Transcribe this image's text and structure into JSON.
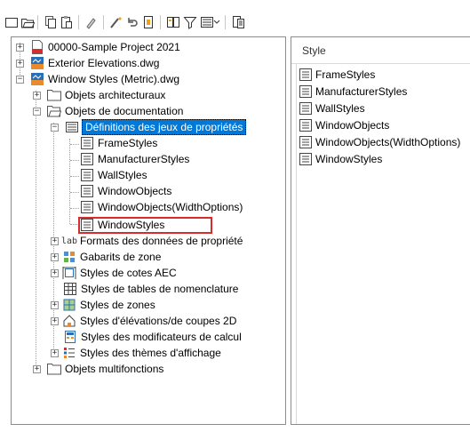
{
  "toolbar": {
    "buttons": [
      "new-icon",
      "open-icon",
      "copy-icon",
      "paste-icon",
      "purge-icon",
      "repath-icon",
      "undo-icon",
      "transfer-icon",
      "compare-icon",
      "filter-icon",
      "view-mode-icon",
      "dropdown-icon",
      "publish-icon"
    ]
  },
  "tree": {
    "items": [
      {
        "label": "00000-Sample Project 2021",
        "icon": "pdf-file-icon"
      },
      {
        "label": "Exterior Elevations.dwg",
        "icon": "dwg-file-icon"
      },
      {
        "label": "Window Styles (Metric).dwg",
        "icon": "dwg-file-icon"
      },
      {
        "label": "Objets architecturaux",
        "icon": "folder-icon"
      },
      {
        "label": "Objets de documentation",
        "icon": "folder-open-icon"
      },
      {
        "label": "Définitions des jeux de propriétés",
        "icon": "property-set-icon"
      },
      {
        "label": "FrameStyles",
        "icon": "style-icon"
      },
      {
        "label": "ManufacturerStyles",
        "icon": "style-icon"
      },
      {
        "label": "WallStyles",
        "icon": "style-icon"
      },
      {
        "label": "WindowObjects",
        "icon": "style-icon"
      },
      {
        "label": "WindowObjects(WidthOptions)",
        "icon": "style-icon"
      },
      {
        "label": "WindowStyles",
        "icon": "style-icon"
      },
      {
        "label": "Formats des données de propriété",
        "icon": "label-format-icon"
      },
      {
        "label": "Gabarits de zone",
        "icon": "zone-template-icon"
      },
      {
        "label": "Styles de cotes AEC",
        "icon": "dimension-style-icon"
      },
      {
        "label": "Styles de tables de nomenclature",
        "icon": "schedule-table-icon"
      },
      {
        "label": "Styles de zones",
        "icon": "zone-style-icon"
      },
      {
        "label": "Styles d'élévations/de coupes 2D",
        "icon": "elevation-section-icon"
      },
      {
        "label": "Styles des modificateurs de calcul",
        "icon": "calc-modifier-icon"
      },
      {
        "label": "Styles des thèmes d'affichage",
        "icon": "display-theme-icon"
      },
      {
        "label": "Objets multifonctions",
        "icon": "folder-icon"
      }
    ]
  },
  "list": {
    "header": "Style",
    "items": [
      "FrameStyles",
      "ManufacturerStyles",
      "WallStyles",
      "WindowObjects",
      "WindowObjects(WidthOptions)",
      "WindowStyles"
    ]
  },
  "colors": {
    "selection": "#0078d7",
    "highlight_box": "#d92b2b"
  }
}
